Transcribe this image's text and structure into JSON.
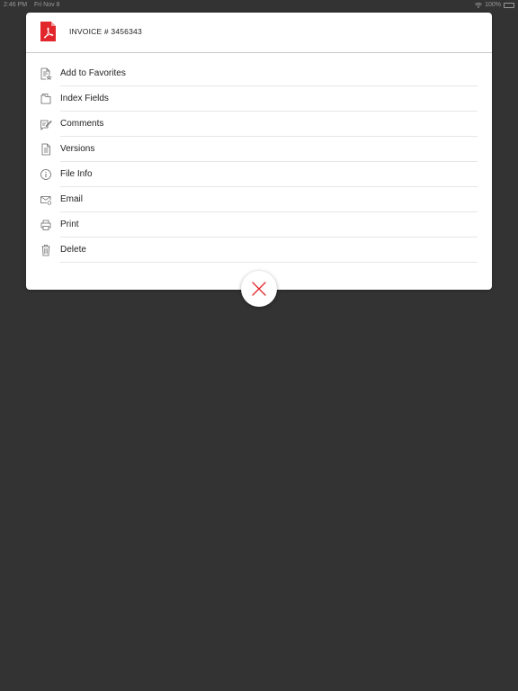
{
  "status_bar": {
    "time": "2:46 PM",
    "date": "Fri Nov 8",
    "battery": "100%"
  },
  "document": {
    "title": "INVOICE # 3456343",
    "icon": "pdf-file-icon",
    "accent_color": "#e1272c"
  },
  "menu": {
    "items": [
      {
        "label": "Add to Favorites",
        "icon": "favorites-doc-icon"
      },
      {
        "label": "Index Fields",
        "icon": "index-fields-icon"
      },
      {
        "label": "Comments",
        "icon": "comment-edit-icon"
      },
      {
        "label": "Versions",
        "icon": "document-versions-icon"
      },
      {
        "label": "File Info",
        "icon": "info-icon"
      },
      {
        "label": "Email",
        "icon": "email-icon"
      },
      {
        "label": "Print",
        "icon": "printer-icon"
      },
      {
        "label": "Delete",
        "icon": "trash-icon"
      }
    ]
  },
  "close_button": {
    "icon": "close-icon",
    "color": "#e1272c"
  }
}
